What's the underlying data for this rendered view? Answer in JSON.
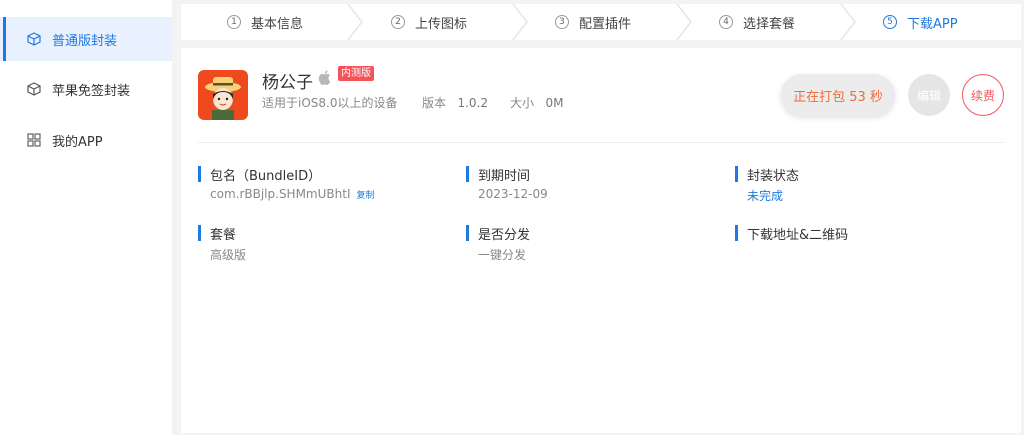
{
  "sidebar": {
    "items": [
      {
        "label": "普通版封装",
        "icon": "cube-icon"
      },
      {
        "label": "苹果免签封装",
        "icon": "cube-icon"
      },
      {
        "label": "我的APP",
        "icon": "grid-icon"
      }
    ]
  },
  "steps": [
    {
      "num": "1",
      "label": "基本信息"
    },
    {
      "num": "2",
      "label": "上传图标"
    },
    {
      "num": "3",
      "label": "配置插件"
    },
    {
      "num": "4",
      "label": "选择套餐"
    },
    {
      "num": "5",
      "label": "下载APP"
    }
  ],
  "app": {
    "name": "杨公子",
    "badge": "内测版",
    "compat": "适用于iOS8.0以上的设备",
    "version_label": "版本",
    "version": "1.0.2",
    "size_label": "大小",
    "size": "0M"
  },
  "actions": {
    "packing": "正在打包 53 秒",
    "edit": "编辑",
    "renew": "续费"
  },
  "info": {
    "bundle_label": "包名（BundleID）",
    "bundle_value": "com.rBBjlp.SHMmUBhtI",
    "copy": "复制",
    "expire_label": "到期时间",
    "expire_value": "2023-12-09",
    "status_label": "封装状态",
    "status_value": "未完成",
    "plan_label": "套餐",
    "plan_value": "高级版",
    "distribute_label": "是否分发",
    "distribute_value": "一键分发",
    "download_label": "下载地址&二维码"
  },
  "colors": {
    "accent": "#1f7ae0",
    "badge": "#f5535a",
    "packing_text": "#f26b3a",
    "renew": "#f2595f"
  }
}
